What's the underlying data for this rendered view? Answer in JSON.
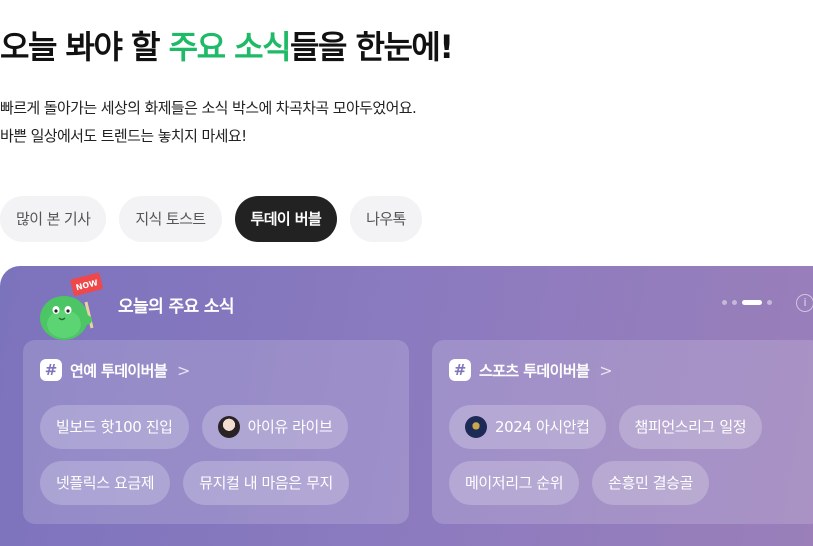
{
  "headline": {
    "before": "오늘 봐야 할 ",
    "highlight": "주요 소식",
    "after": "들을 한눈에!"
  },
  "description": {
    "line1": "빠르게 돌아가는 세상의 화제들은 소식 박스에 차곡차곡 모아두었어요.",
    "line2": "바쁜 일상에서도 트렌드는 놓치지 마세요!"
  },
  "tabs": [
    {
      "label": "많이 본 기사",
      "active": false
    },
    {
      "label": "지식 토스트",
      "active": false
    },
    {
      "label": "투데이 버블",
      "active": true
    },
    {
      "label": "나우톡",
      "active": false
    }
  ],
  "panel": {
    "badge": "NOW",
    "title": "오늘의 주요 소식",
    "info_icon": "i",
    "pager": {
      "total": 4,
      "active": 3
    }
  },
  "cards": [
    {
      "hash": "#",
      "title": "연예 투데이버블",
      "chevron": ">",
      "chips": [
        {
          "label": "빌보드 핫100 진입",
          "icon": null
        },
        {
          "label": "아이유 라이브",
          "icon": "person-thumbnail"
        },
        {
          "label": "넷플릭스 요금제",
          "icon": null
        },
        {
          "label": "뮤지컬 내 마음은 무지",
          "icon": null
        }
      ]
    },
    {
      "hash": "#",
      "title": "스포츠 투데이버블",
      "chevron": ">",
      "chips": [
        {
          "label": "2024 아시안컵",
          "icon": "trophy-thumbnail"
        },
        {
          "label": "챔피언스리그 일정",
          "icon": null
        },
        {
          "label": "메이저리그 순위",
          "icon": null
        },
        {
          "label": "손흥민 결승골",
          "icon": null
        }
      ]
    }
  ],
  "colors": {
    "accent": "#1fba67",
    "active_tab": "#222222",
    "panel_start": "#7c73bd",
    "panel_end": "#9a7fb9"
  }
}
